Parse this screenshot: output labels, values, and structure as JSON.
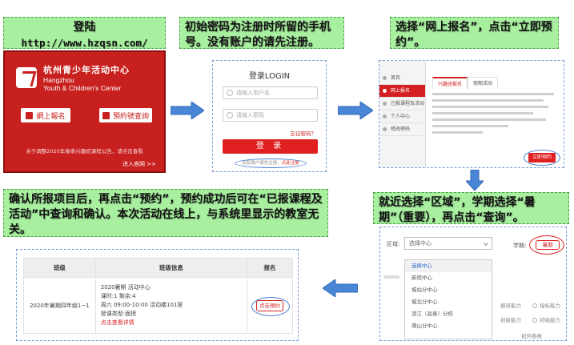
{
  "colors": {
    "callout_bg": "#a8f0a0",
    "arrow": "#4a86d6",
    "brand_red": "#c8201e",
    "ring_blue": "#4a7fd6"
  },
  "callouts": {
    "step1_line1": "登陆",
    "step1_line2": "http://www.hzqsn.com/",
    "step2": "初始密码为注册时所留的手机号。没有账户的请先注册。",
    "step3": "选择“网上报名”，点击“立即预约”。",
    "step4": "就近选择“区域”，学期选择“暑期”（重要），再点击“查询”。",
    "step5": "确认所报项目后，再点击“预约”，预约成功后可在“已报课程及活动”中查询和确认。本次活动在线上，与系统里显示的教室无关。"
  },
  "panel1": {
    "logo_cn": "杭州青少年活动中心",
    "logo_en_1": "Hangzhou",
    "logo_en_2": "Youth & Children's Center",
    "btn_signup": "網上報名",
    "btn_query": "預約號查詢",
    "notice": "关于调整2020年春季兴趣班课程公告，请点击查看",
    "enter": "进入官网 >>"
  },
  "panel2": {
    "title": "登录LOGIN",
    "username_placeholder": "请输入用户名",
    "password_placeholder": "请输入密码",
    "forgot": "忘记密码？",
    "login_button": "登 录",
    "register_text": "没有账户请先注册，",
    "register_link": "点此注册"
  },
  "panel3": {
    "sidebar": [
      "首页",
      "网上报名",
      "已报课程及活动",
      "个人中心",
      "修改密码"
    ],
    "tabs": [
      "兴趣班报名",
      "假期活动"
    ],
    "now_button": "立即预约"
  },
  "panel4": {
    "area_label": "区域:",
    "area_value": "选择中心",
    "term_label": "学期:",
    "term_value": "暑期",
    "options": [
      "选择中心",
      "新馆中心",
      "城站分中心",
      "城北分中心",
      "滨江（昌泰）分校",
      "萧山分中心"
    ],
    "right_rows": [
      "报班能力",
      "初级能力",
      "如何参报"
    ],
    "right_checks": [
      "指标能力",
      "初级能力"
    ]
  },
  "panel5": {
    "headers": [
      "班级",
      "班级信息",
      "报名"
    ],
    "row": {
      "class_name": "2020年暑期四年级1~1",
      "info_line1": "2020暑期 活动中心",
      "info_line2": "课时:1 剩余:4",
      "info_line3": "周六 09:00-10:00 活动楼101室",
      "info_line4": "授课类型:面授",
      "info_detail": "点击查看详情",
      "book_button": "点击预约"
    }
  }
}
